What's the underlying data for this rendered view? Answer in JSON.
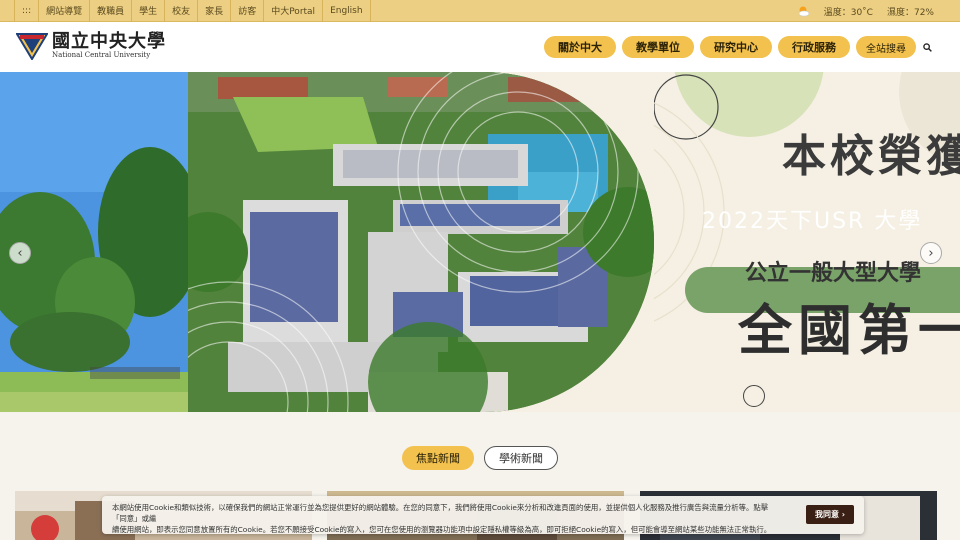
{
  "topbar": {
    "links": [
      ":::",
      "網站導覽",
      "教職員",
      "學生",
      "校友",
      "家長",
      "訪客",
      "中大Portal",
      "English"
    ],
    "temperature": "溫度：30˚C",
    "humidity": "濕度：72%"
  },
  "header": {
    "logo_cn": "國立中央大學",
    "logo_en": "National Central University",
    "nav": [
      "關於中大",
      "教學單位",
      "研究中心",
      "行政服務",
      "全站搜尋"
    ]
  },
  "hero": {
    "headline_1": "本校榮獲",
    "headline_2": "2022天下USR 大學",
    "headline_3": "公立一般大型大學",
    "headline_4": "全國第一",
    "prev_label": "‹",
    "next_label": "›"
  },
  "news": {
    "tabs": [
      "焦點新聞",
      "學術新聞"
    ]
  },
  "cookie": {
    "line1": "本網站使用Cookie和類似技術，以確保我們的網站正常運行並為您提供更好的網站體驗。在您的同意下，我們將使用Cookie來分析和改進頁面的使用，並提供個人化服務及推行廣告與流量分析等。點擊「同意」或繼",
    "line2": "續使用網站，即表示您同意放置所有的Cookie。若您不願接受Cookie的寫入，您可在您使用的瀏覽器功能項中設定隱私權等級為高，即可拒絕Cookie的寫入，但可能會導至網站某些功能無法正常執行。",
    "button": "我同意 ›"
  },
  "colors": {
    "accent_gold": "#f2c14e",
    "topbar": "#eccf83",
    "usr_green": "#7aa36a",
    "cookie_button": "#3a1f14"
  }
}
